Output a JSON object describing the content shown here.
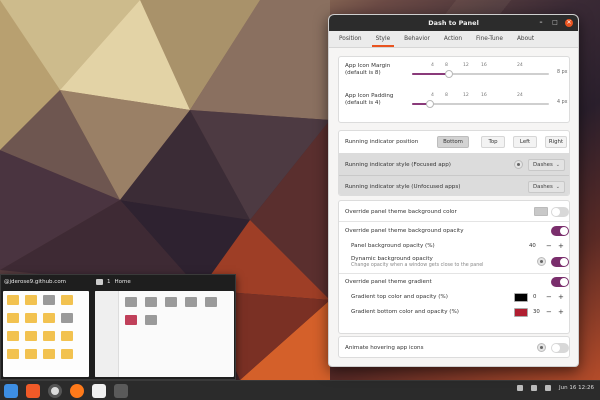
{
  "window": {
    "title": "Dash to Panel",
    "minimize_glyph": "–",
    "maximize_glyph": "□",
    "close_glyph": "✕"
  },
  "tabs": [
    {
      "label": "Position"
    },
    {
      "label": "Style"
    },
    {
      "label": "Behavior"
    },
    {
      "label": "Action"
    },
    {
      "label": "Fine-Tune"
    },
    {
      "label": "About"
    }
  ],
  "icon_margin": {
    "label_line1": "App Icon Margin",
    "label_line2": "(default is 8)",
    "ticks": [
      "0",
      "4",
      "8",
      "12",
      "16",
      "24"
    ],
    "value": 8,
    "unit": "8 px"
  },
  "icon_padding": {
    "label_line1": "App Icon Padding",
    "label_line2": "(default is 4)",
    "ticks": [
      "0",
      "4",
      "8",
      "12",
      "16",
      "24"
    ],
    "value": 4,
    "unit": "4 px"
  },
  "indicator": {
    "position_label": "Running indicator position",
    "position_options": [
      "Bottom",
      "Top",
      "Left",
      "Right"
    ],
    "position_selected": "Bottom",
    "focused_label": "Running indicator style (Focused app)",
    "focused_value": "Dashes",
    "unfocused_label": "Running indicator style (Unfocused apps)",
    "unfocused_value": "Dashes"
  },
  "background": {
    "override_color_label": "Override panel theme background color",
    "override_opacity_label": "Override panel theme background opacity",
    "panel_opacity_label": "Panel background opacity (%)",
    "panel_opacity_value": "40",
    "dynamic_label": "Dynamic background opacity",
    "dynamic_sub": "Change opacity when a window gets close to the panel",
    "override_gradient_label": "Override panel theme gradient",
    "gradient_top_label": "Gradient top color and opacity (%)",
    "gradient_top_color": "#000000",
    "gradient_top_value": "0",
    "gradient_bottom_label": "Gradient bottom color and opacity (%)",
    "gradient_bottom_color": "#b01e30",
    "gradient_bottom_value": "30",
    "minus": "−",
    "plus": "+"
  },
  "animate": {
    "label": "Animate hovering app icons"
  },
  "previews": {
    "terminal_title": "@jderose9.github.com",
    "files_count": "1",
    "files_title": "Home"
  },
  "tray": {
    "date_time": "Jun 16  12:26"
  },
  "colors": {
    "accent": "#e95420",
    "toggle_on": "#7a2e6c"
  }
}
